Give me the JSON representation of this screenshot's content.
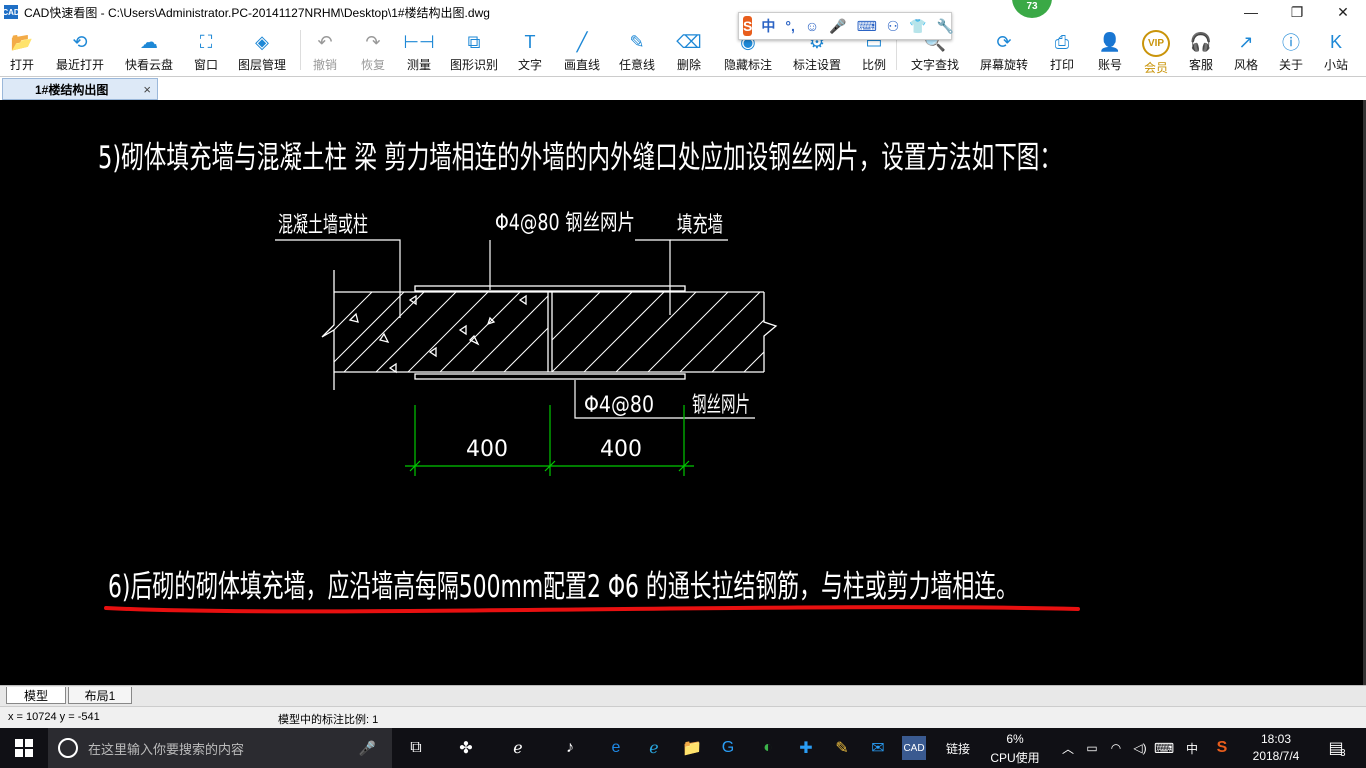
{
  "window": {
    "app_icon": "CAD",
    "title": "CAD快速看图 - C:\\Users\\Administrator.PC-20141127NRHM\\Desktop\\1#楼结构出图.dwg",
    "minimize": "—",
    "restore": "❐",
    "close": "✕"
  },
  "ime": {
    "logo": "S",
    "mode": "中",
    "punct": "°,"
  },
  "badge": "73",
  "toolbar": [
    {
      "label": "打开",
      "icon": "folder-icon",
      "glyph": "📂"
    },
    {
      "label": "最近打开",
      "icon": "history-icon",
      "glyph": "⟲"
    },
    {
      "label": "快看云盘",
      "icon": "cloud-icon",
      "glyph": "☁"
    },
    {
      "label": "窗口",
      "icon": "window-icon",
      "glyph": "⛶"
    },
    {
      "label": "图层管理",
      "icon": "layers-icon",
      "glyph": "◈"
    },
    {
      "label": "撤销",
      "icon": "undo-icon",
      "glyph": "↶",
      "disabled": true
    },
    {
      "label": "恢复",
      "icon": "redo-icon",
      "glyph": "↷",
      "disabled": true
    },
    {
      "label": "测量",
      "icon": "ruler-icon",
      "glyph": "⊢⊣"
    },
    {
      "label": "图形识别",
      "icon": "shape-recognize-icon",
      "glyph": "⧉"
    },
    {
      "label": "文字",
      "icon": "text-icon",
      "glyph": "T"
    },
    {
      "label": "画直线",
      "icon": "line-icon",
      "glyph": "╱"
    },
    {
      "label": "任意线",
      "icon": "pen-icon",
      "glyph": "✎"
    },
    {
      "label": "删除",
      "icon": "eraser-icon",
      "glyph": "⌫"
    },
    {
      "label": "隐藏标注",
      "icon": "eye-icon",
      "glyph": "◉"
    },
    {
      "label": "标注设置",
      "icon": "settings-icon",
      "glyph": "⚙"
    },
    {
      "label": "比例",
      "icon": "scale-icon",
      "glyph": "▭"
    },
    {
      "label": "文字查找",
      "icon": "text-search-icon",
      "glyph": "🔍"
    },
    {
      "label": "屏幕旋转",
      "icon": "rotate-icon",
      "glyph": "⟳"
    },
    {
      "label": "打印",
      "icon": "printer-icon",
      "glyph": "⎙"
    },
    {
      "label": "账号",
      "icon": "user-icon",
      "glyph": "👤"
    },
    {
      "label": "会员",
      "icon": "vip-icon",
      "glyph": "VIP",
      "gold": true
    },
    {
      "label": "客服",
      "icon": "headset-icon",
      "glyph": "🎧"
    },
    {
      "label": "风格",
      "icon": "style-icon",
      "glyph": "↗"
    },
    {
      "label": "关于",
      "icon": "info-icon",
      "glyph": "ⓘ"
    },
    {
      "label": "小站",
      "icon": "k-station-icon",
      "glyph": "K"
    }
  ],
  "doc_tab": {
    "label": "1#楼结构出图",
    "close": "×"
  },
  "drawing": {
    "note5": "5)砌体填充墙与混凝土柱 梁 剪力墙相连的外墙的内外缝口处应加设钢丝网片，设置方法如下图：",
    "label_concrete": "混凝土墙或柱",
    "label_mesh_top": "Φ4@80  钢丝网片",
    "label_infill": "填充墙",
    "label_mesh_bottom_spec": "Φ4@80",
    "label_mesh_bottom_name": "钢丝网片",
    "dim_left": "400",
    "dim_right": "400",
    "note6": "6)后砌的砌体填充墙，应沿墙高每隔500mm配置2 Φ6 的通长拉结钢筋，与柱或剪力墙相连。",
    "colors": {
      "line": "#ffffff",
      "dimension": "#00c800",
      "underline": "#e81010"
    }
  },
  "layout_tabs": [
    "模型",
    "布局1"
  ],
  "status": {
    "coords": "x = 10724  y = -541",
    "scale": "模型中的标注比例: 1"
  },
  "taskbar": {
    "search_placeholder": "在这里输入你要搜索的内容",
    "link_label": "链接",
    "cpu_percent": "6%",
    "cpu_label": "CPU使用",
    "ime": "中",
    "time": "18:03",
    "date": "2018/7/4",
    "notifications_count": "3"
  }
}
